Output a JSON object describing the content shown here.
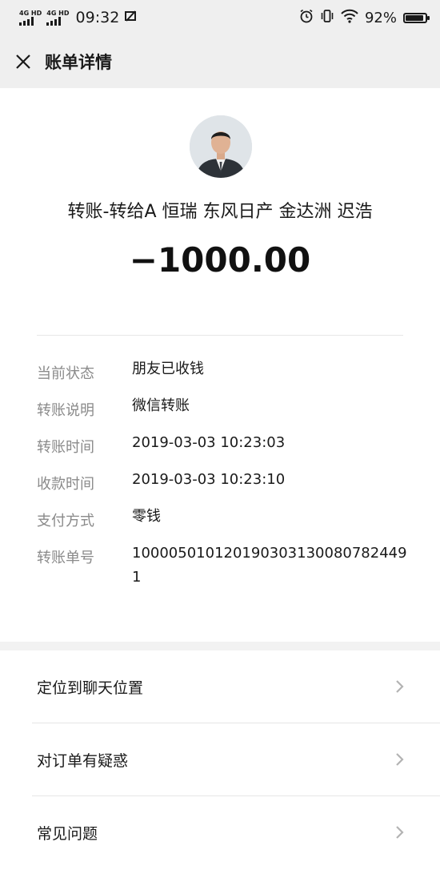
{
  "status_bar": {
    "network_left": "4G HD",
    "network_right": "4G HD",
    "time": "09:32",
    "battery": "92%",
    "battery_level": 0.92
  },
  "nav": {
    "title": "账单详情"
  },
  "detail": {
    "payee": "转账-转给A 恒瑞 东风日产 金达洲 迟浩",
    "amount": "−1000.00",
    "rows": [
      {
        "label": "当前状态",
        "value": "朋友已收钱"
      },
      {
        "label": "转账说明",
        "value": "微信转账"
      },
      {
        "label": "转账时间",
        "value": "2019-03-03 10:23:03"
      },
      {
        "label": "收款时间",
        "value": "2019-03-03 10:23:10"
      },
      {
        "label": "支付方式",
        "value": "零钱"
      },
      {
        "label": "转账单号",
        "value": "1000050101201903031300807824491"
      }
    ]
  },
  "menu": {
    "items": [
      {
        "label": "定位到聊天位置"
      },
      {
        "label": "对订单有疑惑"
      },
      {
        "label": "常见问题"
      }
    ]
  }
}
